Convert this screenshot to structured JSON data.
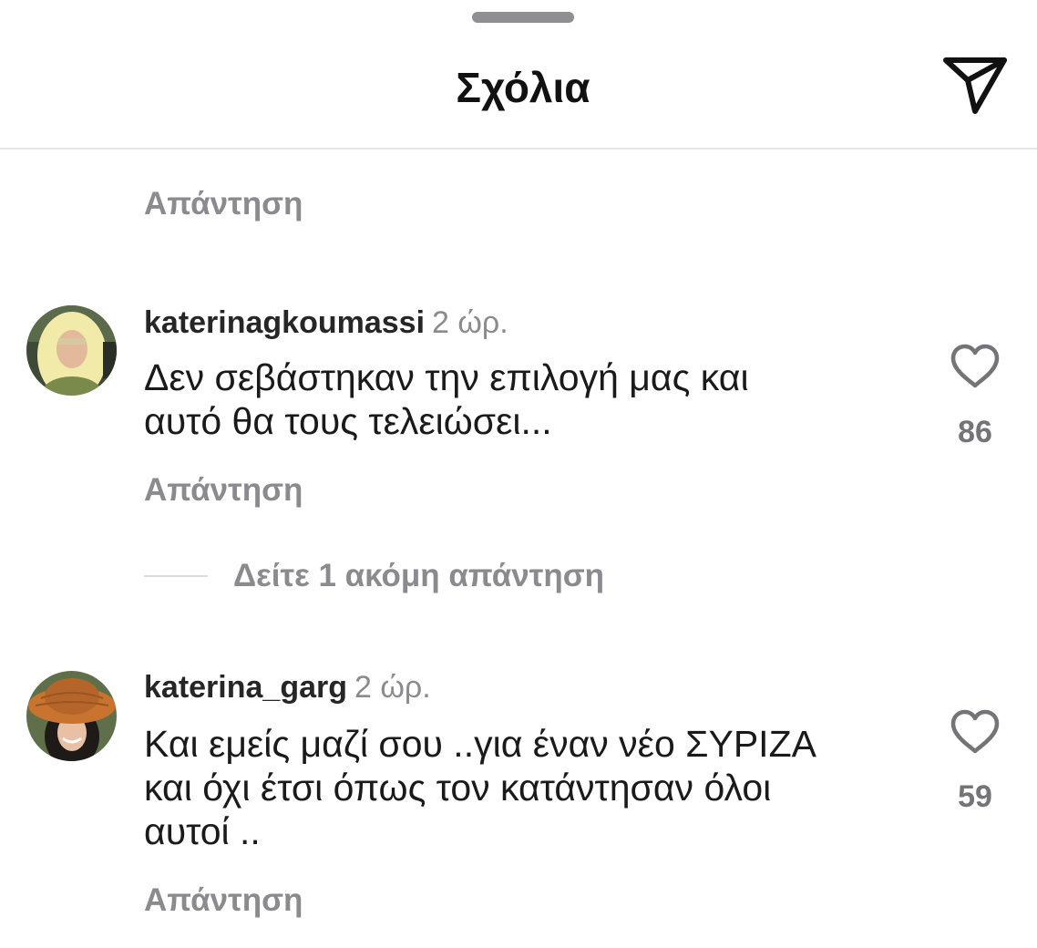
{
  "header": {
    "title": "Σχόλια",
    "share_icon": "send-paper-plane-icon"
  },
  "previous_comment": {
    "reply_label": "Απάντηση"
  },
  "comments": [
    {
      "username": "katerinagkoumassi",
      "time": "2 ώρ.",
      "text": "Δεν σεβάστηκαν την επιλογή μας και\nαυτό θα τους τελειώσει...",
      "like_count": "86",
      "like_icon": "heart-outline-icon",
      "reply_label": "Απάντηση",
      "more_replies_label": "Δείτε 1 ακόμη απάντηση"
    },
    {
      "username": "katerina_garg",
      "time": "2 ώρ.",
      "text": "Και εμείς μαζί σου ..για έναν νέο ΣΥΡΙΖΑ\nκαι όχι έτσι όπως τον κατάντησαν όλοι\nαυτοί ..",
      "like_count": "59",
      "like_icon": "heart-outline-icon",
      "reply_label": "Απάντηση"
    }
  ],
  "colors": {
    "primary_text": "#1a1a1a",
    "secondary_text": "#8a8a8f",
    "divider": "#e6e6e6"
  }
}
